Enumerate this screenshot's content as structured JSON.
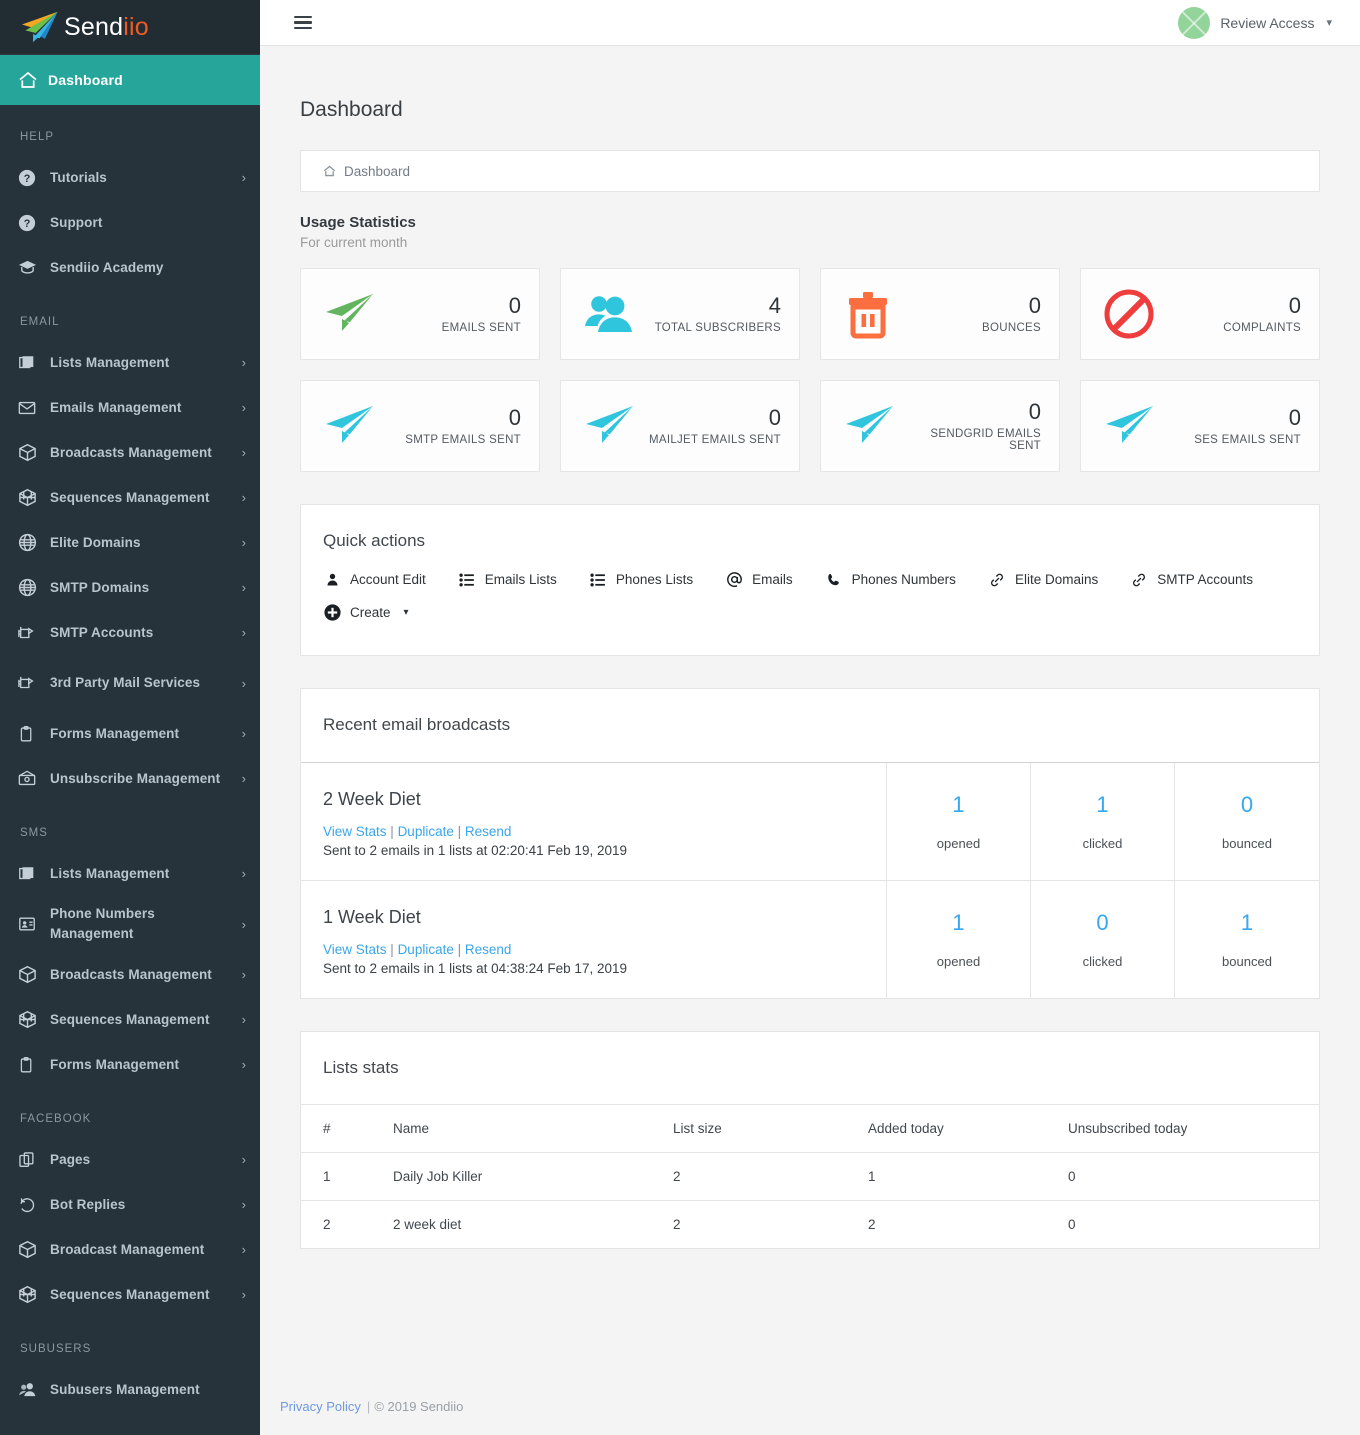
{
  "brand": {
    "name_white": "Send",
    "name_orange": "iio",
    "logo_icon": "paper-plane-logo"
  },
  "header": {
    "menu_icon": "hamburger-icon",
    "user_name": "Review Access",
    "caret_icon": "chevron-down-icon",
    "avatar_icon": "avatar-placeholder"
  },
  "sidebar": {
    "active": {
      "label": "Dashboard",
      "icon": "home-icon"
    },
    "sections": [
      {
        "title": "HELP",
        "items": [
          {
            "label": "Tutorials",
            "icon": "question-circle-icon",
            "chevron": "›"
          },
          {
            "label": "Support",
            "icon": "question-circle-icon",
            "chevron": ""
          },
          {
            "label": "Sendiio Academy",
            "icon": "graduation-cap-icon",
            "chevron": ""
          }
        ]
      },
      {
        "title": "EMAIL",
        "items": [
          {
            "label": "Lists Management",
            "icon": "layers-icon",
            "chevron": "›"
          },
          {
            "label": "Emails Management",
            "icon": "envelope-icon",
            "chevron": "›"
          },
          {
            "label": "Broadcasts Management",
            "icon": "box-icon",
            "chevron": "›"
          },
          {
            "label": "Sequences Management",
            "icon": "cube-grid-icon",
            "chevron": "›"
          },
          {
            "label": "Elite Domains",
            "icon": "globe-icon",
            "chevron": "›"
          },
          {
            "label": "SMTP Domains",
            "icon": "globe-icon",
            "chevron": "›"
          },
          {
            "label": "SMTP Accounts",
            "icon": "mailbox-icon",
            "chevron": "›"
          },
          {
            "label": "3rd Party Mail Services",
            "icon": "mailbox-icon",
            "chevron": "›"
          },
          {
            "label": "Forms Management",
            "icon": "clipboard-icon",
            "chevron": "›"
          },
          {
            "label": "Unsubscribe Management",
            "icon": "envelope-open-icon",
            "chevron": "›"
          }
        ]
      },
      {
        "title": "SMS",
        "items": [
          {
            "label": "Lists Management",
            "icon": "layers-icon",
            "chevron": "›"
          },
          {
            "label": "Phone Numbers Management",
            "icon": "address-card-icon",
            "chevron": "›"
          },
          {
            "label": "Broadcasts Management",
            "icon": "box-icon",
            "chevron": "›"
          },
          {
            "label": "Sequences Management",
            "icon": "cube-grid-icon",
            "chevron": "›"
          },
          {
            "label": "Forms Management",
            "icon": "clipboard-icon",
            "chevron": "›"
          }
        ]
      },
      {
        "title": "FACEBOOK",
        "items": [
          {
            "label": "Pages",
            "icon": "pages-icon",
            "chevron": "›"
          },
          {
            "label": "Bot Replies",
            "icon": "reply-icon",
            "chevron": "›"
          },
          {
            "label": "Broadcast Management",
            "icon": "box-icon",
            "chevron": "›"
          },
          {
            "label": "Sequences Management",
            "icon": "cube-grid-icon",
            "chevron": "›"
          }
        ]
      },
      {
        "title": "SUBUSERS",
        "items": [
          {
            "label": "Subusers Management",
            "icon": "users-icon",
            "chevron": ""
          }
        ]
      }
    ]
  },
  "page": {
    "title": "Dashboard",
    "breadcrumb": {
      "icon": "home-icon",
      "label": "Dashboard"
    },
    "usage": {
      "title": "Usage Statistics",
      "subtitle": "For current month"
    }
  },
  "stats": [
    {
      "value": "0",
      "label": "EMAILS SENT",
      "icon": "paper-plane-green-icon",
      "color": "#62b45f"
    },
    {
      "value": "4",
      "label": "TOTAL SUBSCRIBERS",
      "icon": "users-cyan-icon",
      "color": "#2ec5dd"
    },
    {
      "value": "0",
      "label": "BOUNCES",
      "icon": "trash-orange-icon",
      "color": "#fb6e3f"
    },
    {
      "value": "0",
      "label": "COMPLAINTS",
      "icon": "ban-red-icon",
      "color": "#ef3c3c"
    },
    {
      "value": "0",
      "label": "SMTP EMAILS SENT",
      "icon": "paper-plane-cyan-icon",
      "color": "#2ec5dd"
    },
    {
      "value": "0",
      "label": "MAILJET EMAILS SENT",
      "icon": "paper-plane-cyan-icon",
      "color": "#2ec5dd"
    },
    {
      "value": "0",
      "label": "SENDGRID EMAILS SENT",
      "icon": "paper-plane-cyan-icon",
      "color": "#2ec5dd"
    },
    {
      "value": "0",
      "label": "SES EMAILS SENT",
      "icon": "paper-plane-cyan-icon",
      "color": "#2ec5dd"
    }
  ],
  "quick_actions": {
    "title": "Quick actions",
    "items": [
      {
        "label": "Account Edit",
        "icon": "user-icon"
      },
      {
        "label": "Emails Lists",
        "icon": "list-ul-icon"
      },
      {
        "label": "Phones Lists",
        "icon": "list-ul-icon"
      },
      {
        "label": "Emails",
        "icon": "at-icon"
      },
      {
        "label": "Phones Numbers",
        "icon": "phone-icon"
      },
      {
        "label": "Elite Domains",
        "icon": "link-icon"
      },
      {
        "label": "SMTP Accounts",
        "icon": "link-icon"
      }
    ],
    "create": {
      "label": "Create",
      "icon": "plus-circle-icon",
      "caret": "∨"
    }
  },
  "broadcasts": {
    "title": "Recent email broadcasts",
    "link_separator": " | ",
    "links": {
      "view_stats": "View Stats",
      "duplicate": "Duplicate",
      "resend": "Resend"
    },
    "rows": [
      {
        "name": "2 Week Diet",
        "meta_prefix": "Sent to ",
        "emails": "2",
        "meta_mid": " emails in ",
        "lists": "1",
        "meta_suffix": " lists at 02:20:41 Feb 19, 2019",
        "stats": [
          {
            "value": "1",
            "label": "opened"
          },
          {
            "value": "1",
            "label": "clicked"
          },
          {
            "value": "0",
            "label": "bounced"
          }
        ]
      },
      {
        "name": "1 Week Diet",
        "meta_prefix": "Sent to ",
        "emails": "2",
        "meta_mid": " emails in ",
        "lists": "1",
        "meta_suffix": " lists at 04:38:24 Feb 17, 2019",
        "stats": [
          {
            "value": "1",
            "label": "opened"
          },
          {
            "value": "0",
            "label": "clicked"
          },
          {
            "value": "1",
            "label": "bounced"
          }
        ]
      }
    ]
  },
  "lists_stats": {
    "title": "Lists stats",
    "columns": [
      "#",
      "Name",
      "List size",
      "Added today",
      "Unsubscribed today"
    ],
    "rows": [
      {
        "num": "1",
        "name": "Daily Job Killer",
        "size": "2",
        "added": "1",
        "unsub": "0"
      },
      {
        "num": "2",
        "name": "2 week diet",
        "size": "2",
        "added": "2",
        "unsub": "0"
      }
    ]
  },
  "footer": {
    "privacy": "Privacy Policy",
    "separator": "|",
    "copyright": "© 2019 Sendiio"
  }
}
